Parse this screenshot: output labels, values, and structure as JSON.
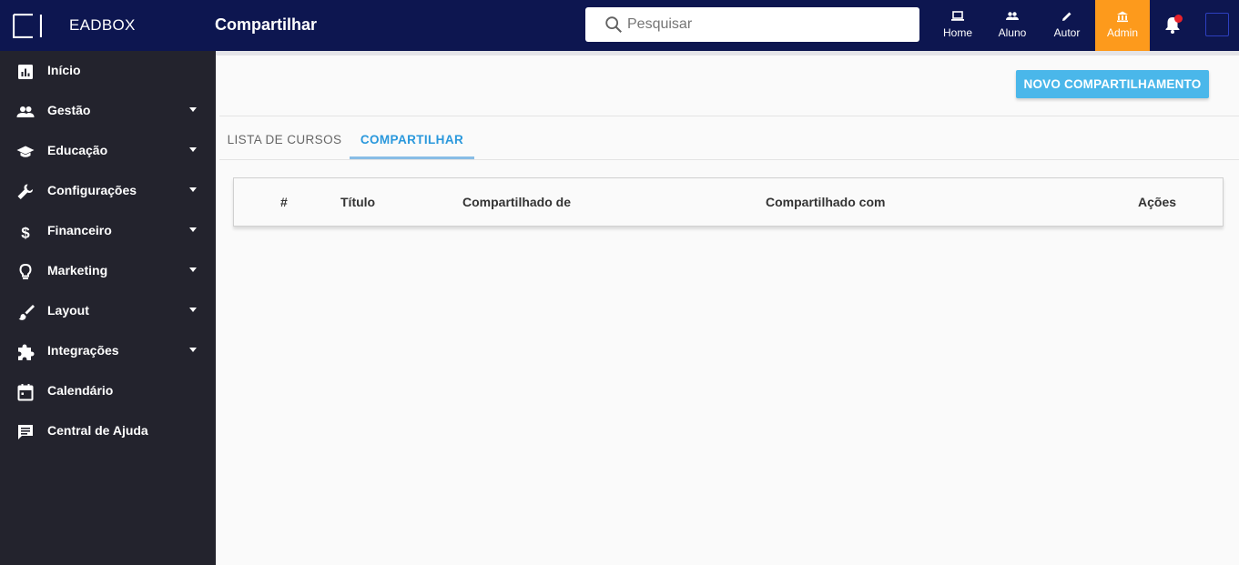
{
  "header": {
    "brand": "EADBOX",
    "page_title": "Compartilhar",
    "search_placeholder": "Pesquisar",
    "nav": [
      {
        "label": "Home",
        "icon": "laptop-icon"
      },
      {
        "label": "Aluno",
        "icon": "people-icon"
      },
      {
        "label": "Autor",
        "icon": "pencil-icon"
      },
      {
        "label": "Admin",
        "icon": "bank-icon"
      }
    ],
    "admin_color": "#fd9a1c",
    "bar_color": "#0d1650",
    "notification_dot_color": "#e8222b"
  },
  "sidebar": {
    "items": [
      {
        "label": "Início",
        "icon": "chart-icon",
        "expandable": false
      },
      {
        "label": "Gestão",
        "icon": "people-icon",
        "expandable": true
      },
      {
        "label": "Educação",
        "icon": "graduation-cap-icon",
        "expandable": true
      },
      {
        "label": "Configurações",
        "icon": "wrench-icon",
        "expandable": true
      },
      {
        "label": "Financeiro",
        "icon": "dollar-icon",
        "expandable": true
      },
      {
        "label": "Marketing",
        "icon": "lightbulb-icon",
        "expandable": true
      },
      {
        "label": "Layout",
        "icon": "brush-icon",
        "expandable": true
      },
      {
        "label": "Integrações",
        "icon": "puzzle-icon",
        "expandable": true
      },
      {
        "label": "Calendário",
        "icon": "calendar-icon",
        "expandable": false
      },
      {
        "label": "Central de Ajuda",
        "icon": "chat-icon",
        "expandable": false
      }
    ]
  },
  "main": {
    "new_button": "NOVO COMPARTILHAMENTO",
    "tabs": [
      {
        "label": "LISTA DE CURSOS",
        "active": false
      },
      {
        "label": "COMPARTILHAR",
        "active": true
      }
    ],
    "table": {
      "columns": [
        "#",
        "Título",
        "Compartilhado de",
        "Compartilhado com",
        "Ações"
      ]
    }
  }
}
